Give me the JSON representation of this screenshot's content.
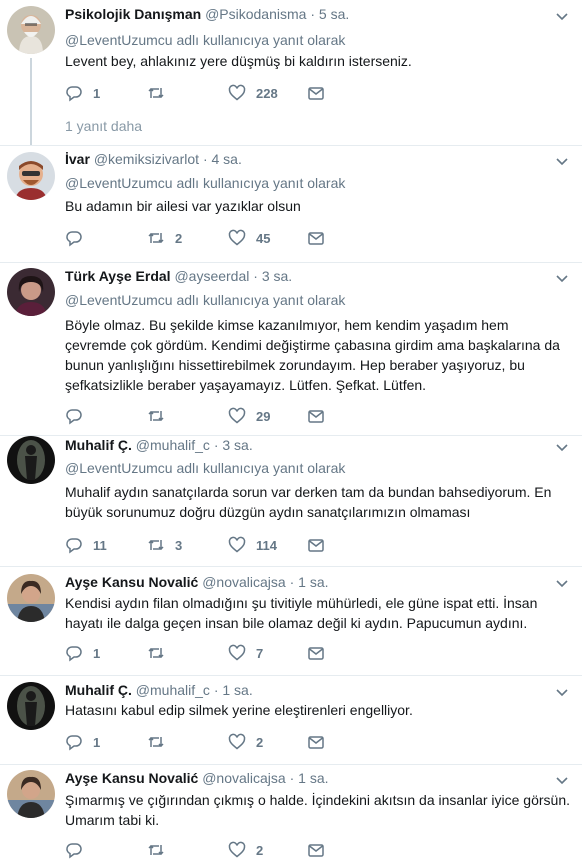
{
  "reply_to_label": "adlı kullanıcıya yanıt olarak",
  "more_replies": "1 yanıt daha",
  "tweets": [
    {
      "name": "Psikolojik Danışman",
      "handle": "@Psikodanisma",
      "time": "5 sa.",
      "mention": "@LeventUzumcu",
      "text": "Levent bey, ahlakınız yere düşmüş bi kaldırın isterseniz.",
      "replies": "1",
      "retweets": "",
      "likes": "228"
    },
    {
      "name": "İvar",
      "handle": "@kemiksizivarlot",
      "time": "4 sa.",
      "mention": "@LeventUzumcu",
      "text": "Bu adamın bir ailesi var yazıklar olsun",
      "replies": "",
      "retweets": "2",
      "likes": "45"
    },
    {
      "name": "Türk Ayşe Erdal",
      "handle": "@ayseerdal",
      "time": "3 sa.",
      "mention": "@LeventUzumcu",
      "text": "Böyle olmaz. Bu şekilde kimse kazanılmıyor, hem kendim yaşadım hem çevremde çok gördüm. Kendimi değiştirme çabasına girdim ama başkalarına da bunun yanlışlığını hissettirebilmek zorundayım. Hep beraber yaşıyoruz, bu şefkatsizlikle beraber yaşayamayız. Lütfen. Şefkat. Lütfen.",
      "replies": "",
      "retweets": "",
      "likes": "29"
    },
    {
      "name": "Muhalif Ç.",
      "handle": "@muhalif_c",
      "time": "3 sa.",
      "mention": "@LeventUzumcu",
      "text": "Muhalif aydın sanatçılarda sorun var derken tam da bundan bahsediyorum. En büyük sorunumuz doğru düzgün aydın sanatçılarımızın olmaması",
      "replies": "11",
      "retweets": "3",
      "likes": "114"
    },
    {
      "name": "Ayşe Kansu Novalić",
      "handle": "@novalicajsa",
      "time": "1 sa.",
      "mention": "",
      "text": "Kendisi aydın filan olmadığını şu tivitiyle mühürledi, ele güne ispat etti. İnsan hayatı ile dalga geçen insan bile olamaz değil ki aydın. Papucumun aydını.",
      "replies": "1",
      "retweets": "",
      "likes": "7"
    },
    {
      "name": "Muhalif Ç.",
      "handle": "@muhalif_c",
      "time": "1 sa.",
      "mention": "",
      "text": "Hatasını kabul edip silmek yerine eleştirenleri engelliyor.",
      "replies": "1",
      "retweets": "",
      "likes": "2"
    },
    {
      "name": "Ayşe Kansu Novalić",
      "handle": "@novalicajsa",
      "time": "1 sa.",
      "mention": "",
      "text": "Şımarmış ve çığırından çıkmış o halde. İçindekini akıtsın da insanlar iyice görsün. Umarım tabi ki.",
      "replies": "",
      "retweets": "",
      "likes": "2"
    }
  ]
}
